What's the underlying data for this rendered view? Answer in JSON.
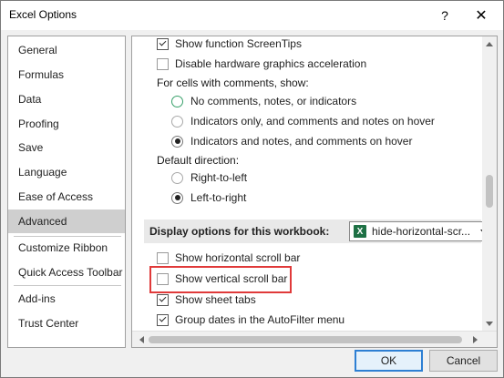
{
  "window": {
    "title": "Excel Options",
    "help_glyph": "?",
    "close_glyph": "✕"
  },
  "sidebar": {
    "items": [
      {
        "label": "General"
      },
      {
        "label": "Formulas"
      },
      {
        "label": "Data"
      },
      {
        "label": "Proofing"
      },
      {
        "label": "Save"
      },
      {
        "label": "Language"
      },
      {
        "label": "Ease of Access"
      },
      {
        "label": "Advanced",
        "selected": true
      },
      {
        "label": "Customize Ribbon"
      },
      {
        "label": "Quick Access Toolbar"
      },
      {
        "label": "Add-ins"
      },
      {
        "label": "Trust Center"
      }
    ]
  },
  "content": {
    "show_screentips": {
      "label": "Show function ScreenTips",
      "checked": true
    },
    "disable_hw_accel": {
      "label": "Disable hardware graphics acceleration",
      "checked": false
    },
    "comments_heading": "For cells with comments, show:",
    "comments_options": [
      {
        "label": "No comments, notes, or indicators",
        "selected": false
      },
      {
        "label": "Indicators only, and comments and notes on hover",
        "selected": false
      },
      {
        "label": "Indicators and notes, and comments on hover",
        "selected": true
      }
    ],
    "direction_heading": "Default direction:",
    "direction_options": [
      {
        "label": "Right-to-left",
        "selected": false
      },
      {
        "label": "Left-to-right",
        "selected": true
      }
    ],
    "workbook_section": {
      "title": "Display options for this workbook:",
      "selected_workbook": "hide-horizontal-scr...",
      "workbook_icon_letter": "X"
    },
    "show_hscroll": {
      "label": "Show horizontal scroll bar",
      "checked": false
    },
    "show_vscroll": {
      "label": "Show vertical scroll bar",
      "checked": false
    },
    "show_sheet_tabs": {
      "label": "Show sheet tabs",
      "checked": true
    },
    "group_dates": {
      "label": "Group dates in the AutoFilter menu",
      "checked": true
    }
  },
  "footer": {
    "ok_label": "OK",
    "cancel_label": "Cancel"
  },
  "colors": {
    "highlight_border": "#e03a3a",
    "ok_border": "#2d7fd3",
    "selected_sidebar": "#cfcfcf",
    "excel_green": "#1e7145"
  }
}
